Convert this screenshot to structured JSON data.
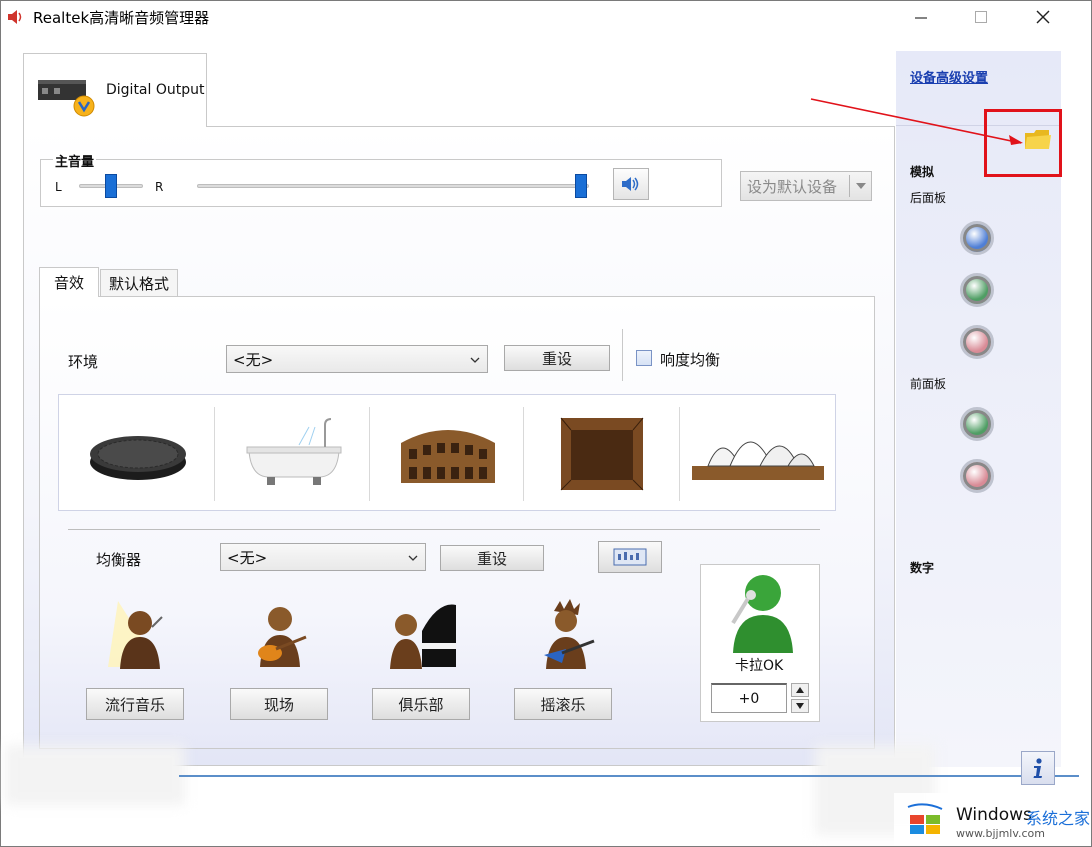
{
  "window": {
    "title": "Realtek高清晰音频管理器",
    "controls": {
      "minimize": "—",
      "maximize": "☐",
      "close": "✕"
    }
  },
  "device_tab": {
    "label": "Digital Output"
  },
  "volume": {
    "legend": "主音量",
    "left_label": "L",
    "right_label": "R",
    "balance": 0.5,
    "level": 1.0
  },
  "default_device_button": {
    "label": "设为默认设备"
  },
  "subtabs": [
    {
      "label": "音效",
      "selected": true
    },
    {
      "label": "默认格式",
      "selected": false
    }
  ],
  "environment": {
    "label": "环境",
    "select_value": "<无>",
    "reset_label": "重设",
    "loudness_label": "响度均衡",
    "loudness_checked": false,
    "presets": [
      "manhole-cover",
      "bathtub",
      "colosseum",
      "stone-room",
      "opera-house"
    ]
  },
  "equalizer": {
    "label": "均衡器",
    "select_value": "<无>",
    "reset_label": "重设",
    "presets": [
      {
        "label": "流行音乐",
        "icon": "pop-singer-icon"
      },
      {
        "label": "现场",
        "icon": "guitarist-icon"
      },
      {
        "label": "俱乐部",
        "icon": "pianist-icon"
      },
      {
        "label": "摇滚乐",
        "icon": "rocker-icon"
      }
    ]
  },
  "karaoke": {
    "label": "卡拉OK",
    "value": "+0"
  },
  "sidebar": {
    "advanced_link": "设备高级设置",
    "analog_label": "模拟",
    "rear_panel_label": "后面板",
    "front_panel_label": "前面板",
    "digital_label": "数字",
    "rear_jacks": [
      "#4f7fd6",
      "#4f9e64",
      "#d98b96"
    ],
    "front_jacks": [
      "#4f9e64",
      "#d98b96"
    ]
  },
  "watermark": {
    "brand": "Windows",
    "brand_cn": "系统之家",
    "url": "www.bjjmlv.com"
  },
  "colors": {
    "accent": "#1a6fd6",
    "highlight": "#e1121a"
  }
}
